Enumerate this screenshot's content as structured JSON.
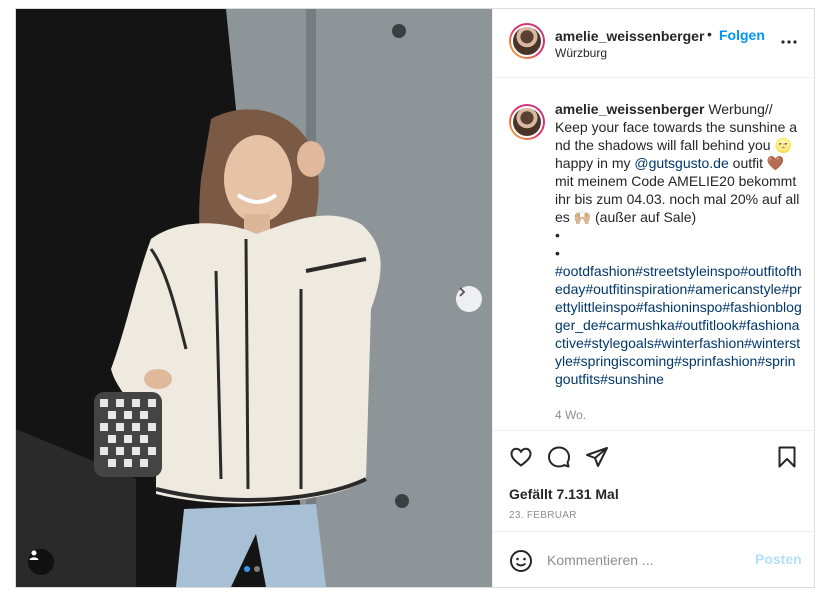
{
  "post": {
    "username": "amelie_weissenberger",
    "header_separator": "•",
    "follow_label": "Folgen",
    "location": "Würzburg",
    "caption": {
      "username": "amelie_weissenberger",
      "line1": "Werbung//",
      "line2": "Keep your face towards the sunshine and the shadows will fall behind you 🌝",
      "line3_before": "happy in my ",
      "mention": "@gutsgusto.de",
      "line3_after": " outfit 🤎",
      "line4": "mit meinem Code AMELIE20 bekommt ihr bis zum 04.03. noch mal 20% auf alles 🙌🏼 (außer auf Sale)",
      "bullet1": "•",
      "bullet2": "•",
      "hashtags": "#ootdfashion#streetstyleinspo#outfitoftheday#outfitinspiration#americanstyle#prettylittleinspo#fashioninspo#fashionblogger_de#carmushka#outfitlook#fashionactive#stylegoals#winterfashion#winterstyle#springiscoming#sprinfashion#springoutfits#sunshine"
    },
    "caption_time": "4 Wo.",
    "likes": "Gefällt 7.131 Mal",
    "date": "23. FEBRUAR",
    "comment_placeholder": "Kommentieren ...",
    "post_label": "Posten",
    "carousel": {
      "total": 2,
      "current": 1
    }
  },
  "icons": {
    "like": "heart-icon",
    "comment": "comment-icon",
    "share": "paper-plane-icon",
    "save": "bookmark-icon",
    "more": "more-dots-icon",
    "emoji": "emoji-icon",
    "next": "chevron-right-icon",
    "tag": "user-tag-icon"
  },
  "colors": {
    "accent": "#0095f6",
    "post_disabled": "#b2dffc",
    "hashtag": "#00376b",
    "muted": "#8e8e8e"
  }
}
